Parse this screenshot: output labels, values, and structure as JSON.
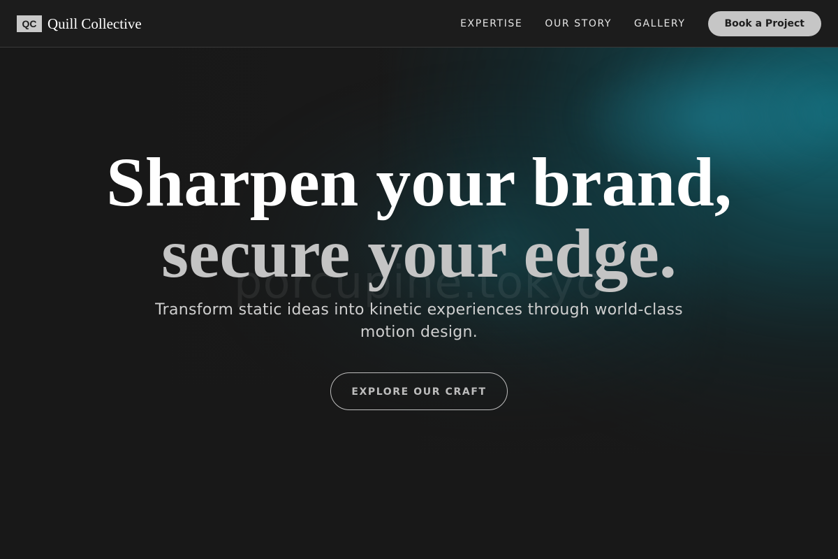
{
  "brand": {
    "mark": "QC",
    "name": "Quill Collective"
  },
  "nav": {
    "items": [
      {
        "label": "EXPERTISE"
      },
      {
        "label": "OUR STORY"
      },
      {
        "label": "GALLERY"
      }
    ],
    "cta_label": "Book a Project"
  },
  "hero": {
    "watermark": "porcupine.tokyo",
    "title_line1": "Sharpen your brand,",
    "title_line2": "secure your edge.",
    "subtitle": "Transform static ideas into kinetic experiences through world-class motion design.",
    "button_label": "EXPLORE OUR CRAFT"
  },
  "colors": {
    "background": "#1a1a1a",
    "accent_teal": "#146e7d",
    "cta_bg": "#c6c6c6"
  }
}
